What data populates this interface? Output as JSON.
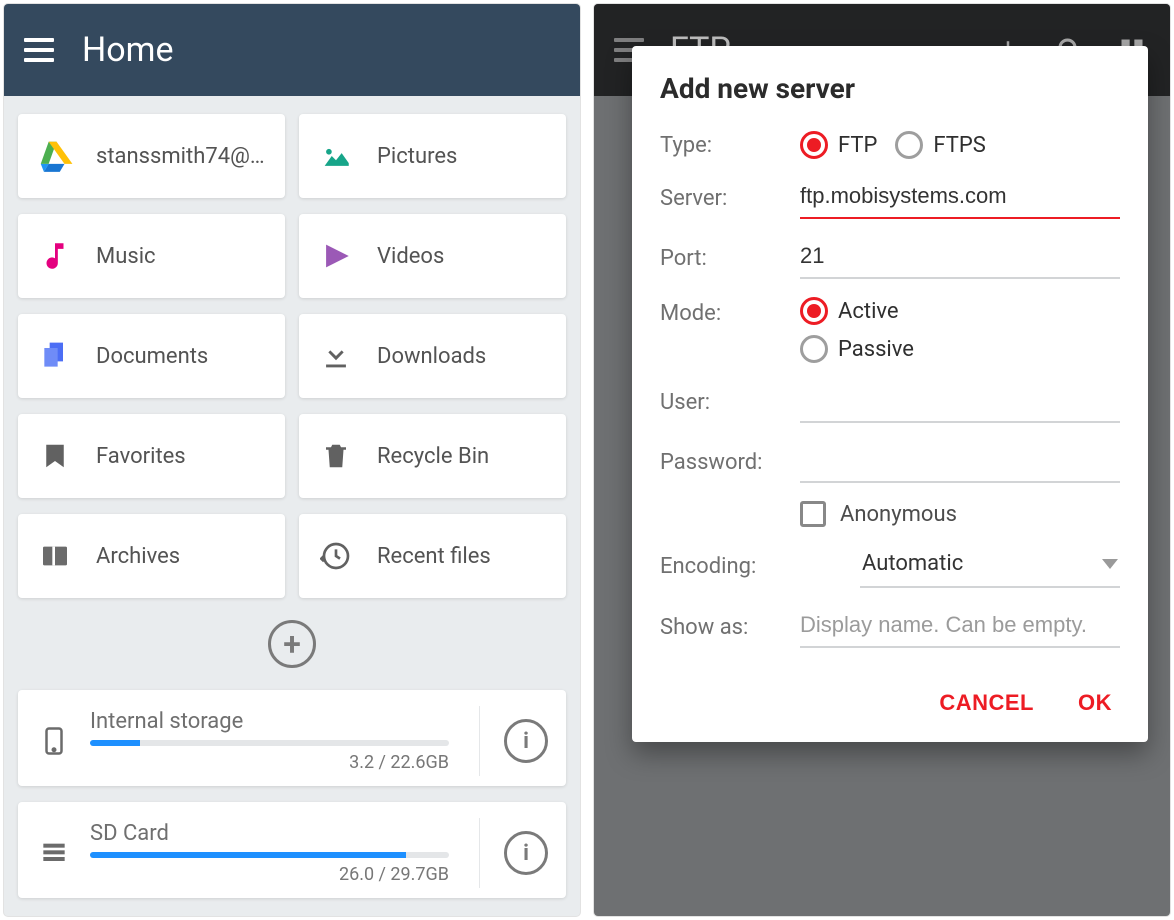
{
  "left": {
    "title": "Home",
    "tiles": [
      {
        "label": "stanssmith74@…"
      },
      {
        "label": "Pictures"
      },
      {
        "label": "Music"
      },
      {
        "label": "Videos"
      },
      {
        "label": "Documents"
      },
      {
        "label": "Downloads"
      },
      {
        "label": "Favorites"
      },
      {
        "label": "Recycle Bin"
      },
      {
        "label": "Archives"
      },
      {
        "label": "Recent files"
      }
    ],
    "storages": [
      {
        "name": "Internal storage",
        "usage_text": "3.2 / 22.6GB",
        "fill_percent": 14
      },
      {
        "name": "SD Card",
        "usage_text": "26.0 / 29.7GB",
        "fill_percent": 88
      }
    ]
  },
  "right": {
    "title": "FTP",
    "dialog": {
      "heading": "Add new server",
      "labels": {
        "type": "Type:",
        "server": "Server:",
        "port": "Port:",
        "mode": "Mode:",
        "user": "User:",
        "password": "Password:",
        "encoding": "Encoding:",
        "show_as": "Show as:"
      },
      "type_options": {
        "ftp": "FTP",
        "ftps": "FTPS"
      },
      "type_selected": "ftp",
      "server_value": "ftp.mobisystems.com",
      "port_value": "21",
      "mode_options": {
        "active": "Active",
        "passive": "Passive"
      },
      "mode_selected": "active",
      "user_value": "",
      "password_value": "",
      "anonymous_label": "Anonymous",
      "anonymous_checked": false,
      "encoding_value": "Automatic",
      "show_as_placeholder": "Display name. Can be empty.",
      "actions": {
        "cancel": "CANCEL",
        "ok": "OK"
      }
    }
  }
}
